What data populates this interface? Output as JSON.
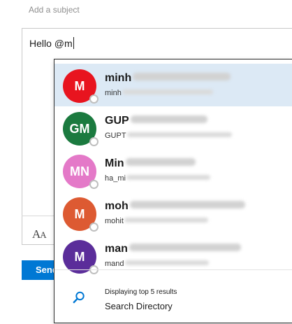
{
  "compose": {
    "subject_placeholder": "Add a subject",
    "body_text": "Hello @m",
    "font_icon_glyph": "AA",
    "send_label": "Send"
  },
  "suggestions": {
    "contacts": [
      {
        "initials": "M",
        "name_visible": "minh",
        "email_visible": "minh",
        "color": "#e8141f",
        "selected": true
      },
      {
        "initials": "GM",
        "name_visible": "GUP",
        "email_visible": "GUPT",
        "color": "#1b7a3f",
        "selected": false
      },
      {
        "initials": "MN",
        "name_visible": "Min",
        "email_visible": "ha_mi",
        "color": "#e479c8",
        "selected": false
      },
      {
        "initials": "M",
        "name_visible": "moh",
        "email_visible": "mohit",
        "color": "#dd5a32",
        "selected": false
      },
      {
        "initials": "M",
        "name_visible": "man",
        "email_visible": "mand",
        "color": "#5b2d9a",
        "selected": false
      }
    ],
    "results_info": "Displaying top 5 results",
    "search_directory_label": "Search Directory"
  },
  "colors": {
    "accent": "#0078d4",
    "selected_row": "#dce9f5"
  },
  "icons": {
    "search": "search-icon",
    "font": "font-size-icon",
    "presence": "presence-status-icon"
  }
}
